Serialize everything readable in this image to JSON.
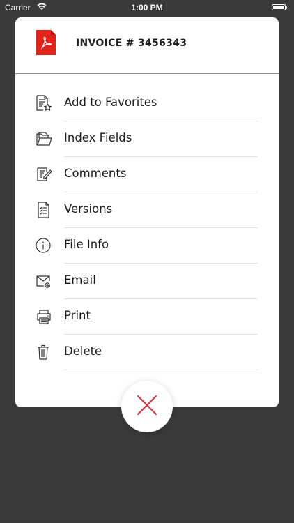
{
  "status_bar": {
    "carrier": "Carrier",
    "time": "1:00 PM",
    "wifi_icon": "wifi-icon",
    "battery_icon": "battery-icon"
  },
  "document": {
    "title": "INVOICE # 3456343",
    "file_type_icon": "pdf-file-icon",
    "accent_color": "#e2231a"
  },
  "menu": {
    "items": [
      {
        "label": "Add to Favorites",
        "icon": "add-favorite-icon"
      },
      {
        "label": "Index Fields",
        "icon": "folder-icon"
      },
      {
        "label": "Comments",
        "icon": "comments-icon"
      },
      {
        "label": "Versions",
        "icon": "versions-icon"
      },
      {
        "label": "File Info",
        "icon": "info-icon"
      },
      {
        "label": "Email",
        "icon": "email-icon"
      },
      {
        "label": "Print",
        "icon": "printer-icon"
      },
      {
        "label": "Delete",
        "icon": "trash-icon"
      }
    ]
  },
  "close_button": {
    "icon": "close-icon",
    "color": "#d9353a"
  },
  "colors": {
    "backdrop": "#3a3a3a",
    "sheet": "#ffffff",
    "text": "#1c1c1c"
  }
}
